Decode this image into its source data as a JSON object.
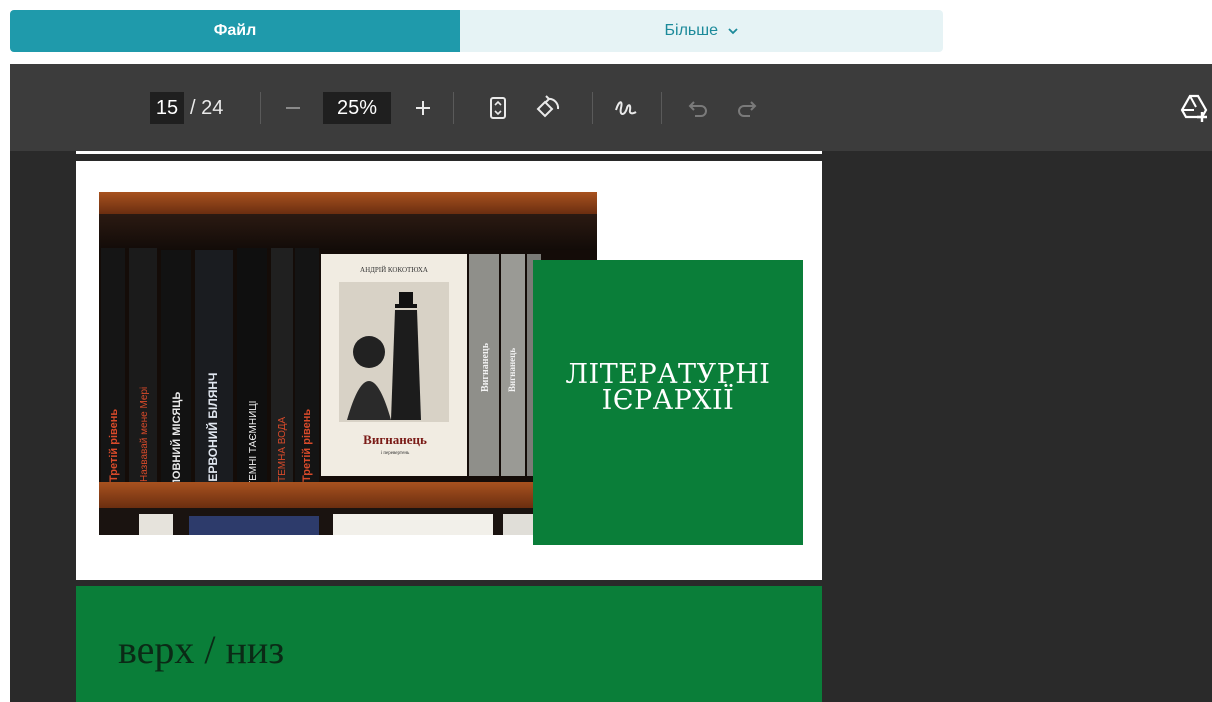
{
  "tabs": {
    "file_label": "Файл",
    "more_label": "Більше"
  },
  "toolbar": {
    "current_page": "15",
    "total_pages": "/ 24",
    "zoom": "25%",
    "icons": [
      "minus-icon",
      "plus-icon",
      "fit-page-icon",
      "rotate-icon",
      "draw-icon",
      "undo-icon",
      "redo-icon",
      "add-to-drive-icon"
    ]
  },
  "slide": {
    "title": "ЛІТЕРАТУРНІ ІЄРАРХІЇ"
  },
  "next_slide": {
    "heading": "верх / низ"
  },
  "photo": {
    "book_spines": [
      "Третій рівень",
      "Назвавай мене Мері",
      "ПОВНИЙ МІСЯЦЬ",
      "ЧЕРВОНИЙ БІЛЯНЧ",
      "ТЕМНІ ТАЄМНИЦІ",
      "ТЕМНА ВОДА",
      "Третій рівень"
    ],
    "book_cover_author": "АНДРІЙ КОКОТЮХА",
    "book_cover_title": "Вигнанець",
    "book_cover_subtitle": "і перевертень",
    "side_spines": [
      "Вигнанець",
      "Вигнанець"
    ]
  },
  "colors": {
    "accent": "#1f9aab",
    "slide_green": "#0a7e39",
    "toolbar_bg": "#3c3c3c",
    "viewer_bg": "#2a2a2a"
  }
}
